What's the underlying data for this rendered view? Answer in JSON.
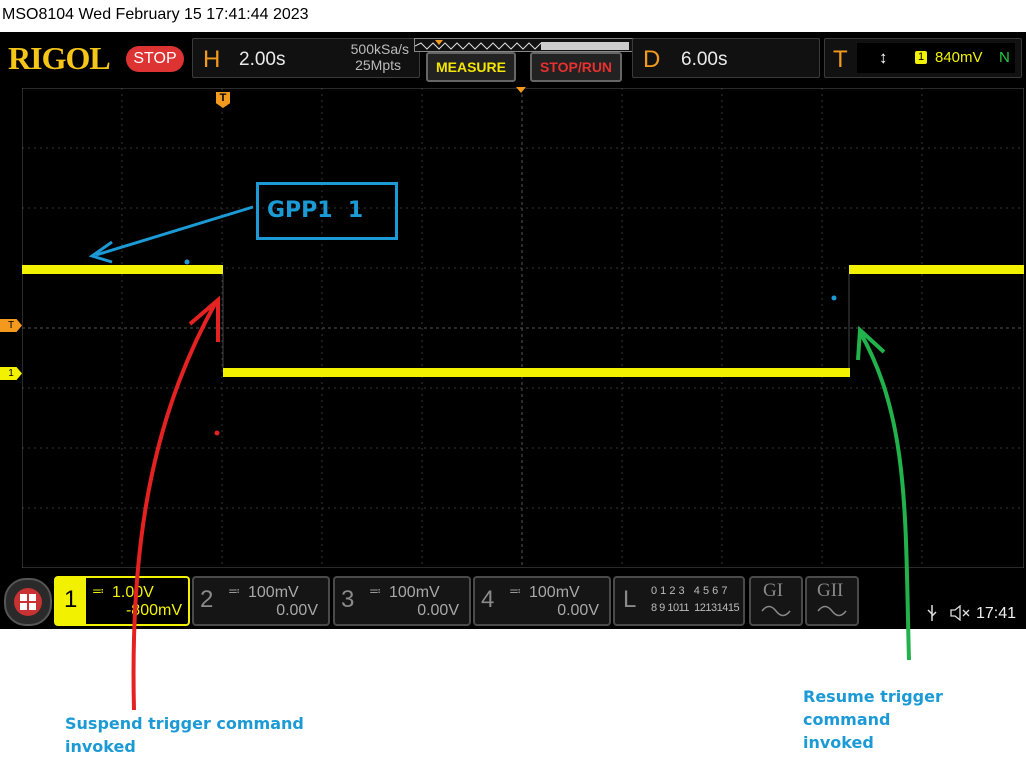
{
  "window": {
    "title": "MSO8104  Wed February 15 17:41:44 2023"
  },
  "header": {
    "logo": "RIGOL",
    "run_state": "STOP",
    "horizontal": {
      "letter": "H",
      "timebase": "2.00s",
      "sample_rate": "500kSa/s",
      "memory_depth": "25Mpts"
    },
    "measure_button": "MEASURE",
    "stop_run_button": "STOP/RUN",
    "delay": {
      "letter": "D",
      "value": "6.00s"
    },
    "trigger": {
      "letter": "T",
      "edge_glyph": "↕",
      "source": "1",
      "level": "840mV",
      "mode": "N"
    }
  },
  "grid": {
    "marker_label_trigger": "T",
    "marker_label_ch1": "1",
    "top_trigger_marker": "T"
  },
  "overlay": {
    "label": "GPP1  1"
  },
  "channels": [
    {
      "num": "1",
      "scale": "1.00V",
      "offset": "-800mV",
      "active": true
    },
    {
      "num": "2",
      "scale": "100mV",
      "offset": "0.00V",
      "active": false
    },
    {
      "num": "3",
      "scale": "100mV",
      "offset": "0.00V",
      "active": false
    },
    {
      "num": "4",
      "scale": "100mV",
      "offset": "0.00V",
      "active": false
    }
  ],
  "logic": {
    "letter": "L",
    "row1": "0 1 2 3   4 5 6 7",
    "row2": "8 9 1011  12131415"
  },
  "gen1": "GI",
  "gen2": "GII",
  "status": {
    "time": "17:41",
    "usb_icon": "usb-icon",
    "mute_icon": "mute-icon"
  },
  "annotations": {
    "suspend": [
      "Suspend trigger command",
      "invoked"
    ],
    "resume": [
      "Resume trigger command",
      "invoked"
    ]
  },
  "colors": {
    "ch1": "#f2f200",
    "orange": "#f39a1e",
    "blue": "#1b9ad6",
    "red": "#e52222",
    "green": "#22b24c"
  }
}
